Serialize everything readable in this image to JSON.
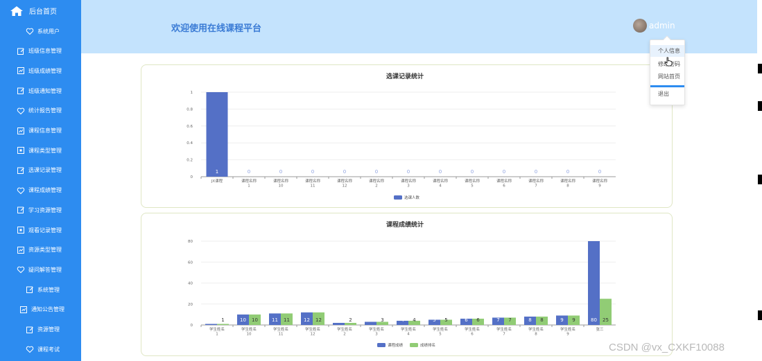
{
  "sidebar": {
    "home_label": "后台首页",
    "items": [
      {
        "label": "系统用户",
        "icon": "heart-icon"
      },
      {
        "label": "班级信息管理",
        "icon": "edit-icon"
      },
      {
        "label": "班级成绩管理",
        "icon": "chart-icon"
      },
      {
        "label": "班级通知管理",
        "icon": "edit-icon"
      },
      {
        "label": "统计报告管理",
        "icon": "heart-icon"
      },
      {
        "label": "课程信息管理",
        "icon": "chart-icon"
      },
      {
        "label": "课程类型管理",
        "icon": "box-icon"
      },
      {
        "label": "选课记录管理",
        "icon": "edit-icon"
      },
      {
        "label": "课程成绩管理",
        "icon": "heart-icon"
      },
      {
        "label": "学习资源管理",
        "icon": "edit-icon"
      },
      {
        "label": "观看记录管理",
        "icon": "box-icon"
      },
      {
        "label": "资源类型管理",
        "icon": "chart-icon"
      },
      {
        "label": "疑问解答管理",
        "icon": "heart-icon"
      },
      {
        "label": "系统管理",
        "icon": "edit-icon"
      },
      {
        "label": "通知公告管理",
        "icon": "chart-icon"
      },
      {
        "label": "资源管理",
        "icon": "edit-icon"
      },
      {
        "label": "课程考试",
        "icon": "heart-icon"
      }
    ]
  },
  "header": {
    "welcome": "欢迎使用在线课程平台",
    "username": "admin"
  },
  "dropdown": {
    "items": [
      "个人信息",
      "修改密码",
      "网站首页"
    ],
    "logout": "退出"
  },
  "charts": {
    "enrollment": {
      "title": "选课记录统计",
      "legend": "选课人数",
      "yticks": [
        "1",
        "0.8",
        "0.6",
        "0.4",
        "0.2",
        "0"
      ]
    },
    "grades": {
      "title": "课程成绩统计",
      "legend": [
        "课程成绩",
        "成绩排名"
      ],
      "yticks": [
        "80",
        "60",
        "40",
        "20",
        "0"
      ]
    }
  },
  "chart_data": [
    {
      "type": "bar",
      "title": "选课记录统计",
      "categories": [
        [
          "JX课程"
        ],
        [
          "课程名称",
          "1"
        ],
        [
          "课程名称",
          "10"
        ],
        [
          "课程名称",
          "11"
        ],
        [
          "课程名称",
          "12"
        ],
        [
          "课程名称",
          "2"
        ],
        [
          "课程名称",
          "3"
        ],
        [
          "课程名称",
          "4"
        ],
        [
          "课程名称",
          "5"
        ],
        [
          "课程名称",
          "6"
        ],
        [
          "课程名称",
          "7"
        ],
        [
          "课程名称",
          "8"
        ],
        [
          "课程名称",
          "9"
        ]
      ],
      "series": [
        {
          "name": "选课人数",
          "values": [
            1,
            0,
            0,
            0,
            0,
            0,
            0,
            0,
            0,
            0,
            0,
            0,
            0
          ]
        }
      ],
      "ylim": [
        0,
        1
      ],
      "legend": "bottom-center",
      "colors": [
        "#5470c6"
      ]
    },
    {
      "type": "bar",
      "title": "课程成绩统计",
      "categories": [
        [
          "学生姓名",
          "1"
        ],
        [
          "学生姓名",
          "10"
        ],
        [
          "学生姓名",
          "11"
        ],
        [
          "学生姓名",
          "12"
        ],
        [
          "学生姓名",
          "2"
        ],
        [
          "学生姓名",
          "3"
        ],
        [
          "学生姓名",
          "4"
        ],
        [
          "学生姓名",
          "5"
        ],
        [
          "学生姓名",
          "6"
        ],
        [
          "学生姓名",
          "7"
        ],
        [
          "学生姓名",
          "8"
        ],
        [
          "学生姓名",
          "9"
        ],
        [
          "张三"
        ]
      ],
      "series": [
        {
          "name": "课程成绩",
          "values": [
            1,
            10,
            11,
            12,
            2,
            3,
            4,
            5,
            6,
            7,
            8,
            9,
            80
          ]
        },
        {
          "name": "成绩排名",
          "values": [
            1,
            10,
            11,
            12,
            2,
            3,
            4,
            5,
            6,
            7,
            8,
            9,
            25
          ]
        }
      ],
      "ylim": [
        0,
        80
      ],
      "legend": "bottom-center",
      "colors": [
        "#5470c6",
        "#91cc75"
      ]
    }
  ],
  "watermark": "CSDN @vx_CXKF10088"
}
